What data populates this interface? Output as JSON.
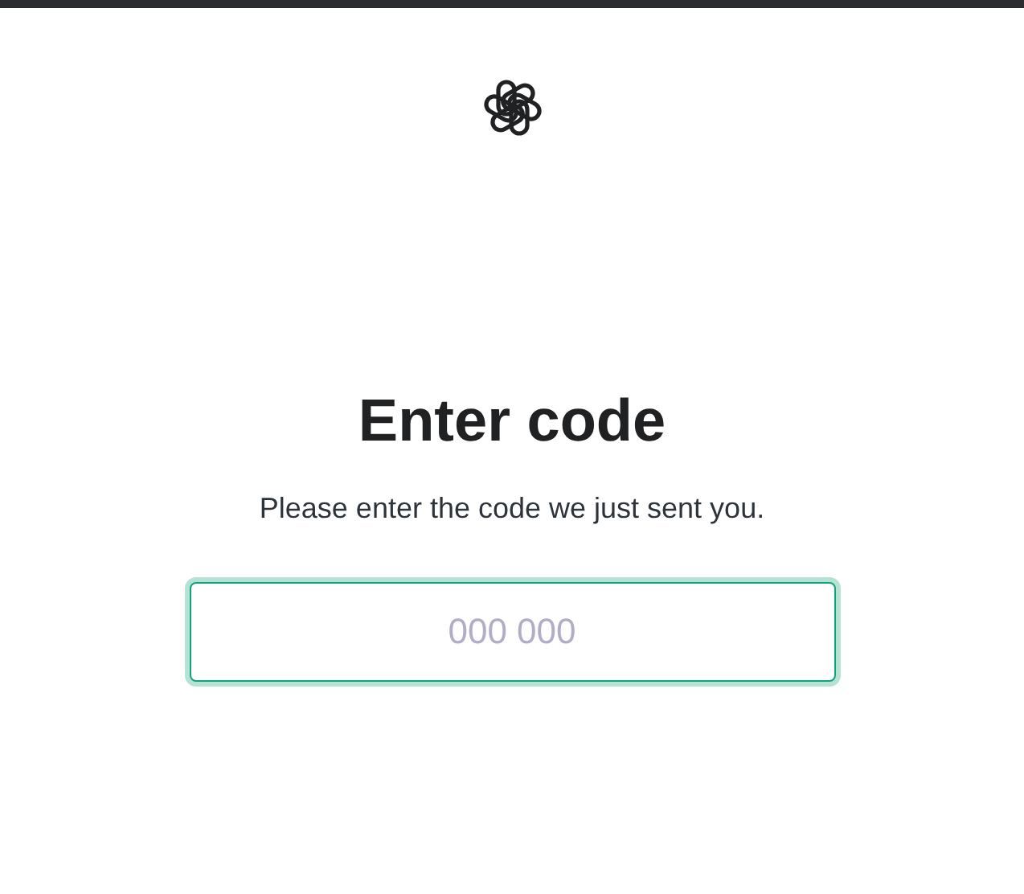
{
  "heading": "Enter code",
  "subtitle": "Please enter the code we just sent you.",
  "code_field": {
    "placeholder": "000 000",
    "focused": true
  }
}
